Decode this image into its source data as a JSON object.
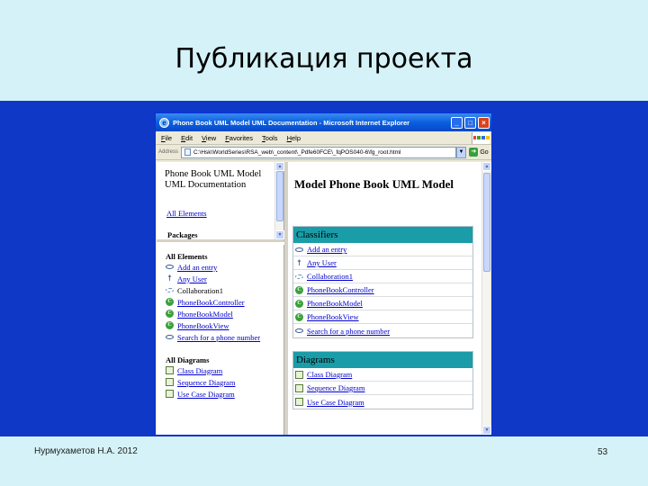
{
  "slide": {
    "title": "Публикация проекта",
    "footer_author": "Нурмухаметов Н.А. 2012",
    "page_number": "53"
  },
  "browser": {
    "title": "Phone Book UML Model UML Documentation - Microsoft Internet Explorer",
    "menu": [
      "File",
      "Edit",
      "View",
      "Favorites",
      "Tools",
      "Help"
    ],
    "address_label": "Address",
    "address": "C:\\Hsk\\WorldSeries\\RSA_web\\_content\\_Pdfe60FCE\\_fqPOS040-6\\fg_root.html",
    "go_label": "Go",
    "window_controls": [
      "minimize-icon",
      "maximize-icon",
      "close-icon"
    ]
  },
  "left_top": {
    "doc_title": "Phone Book UML Model UML Documentation",
    "all_elements_link": "All Elements",
    "packages_label": "Packages"
  },
  "left_bottom": {
    "all_elements_head": "All Elements",
    "elements": [
      {
        "label": "Add an entry",
        "icon": "use-case-icon",
        "link": true
      },
      {
        "label": "Any User",
        "icon": "actor-icon",
        "link": true
      },
      {
        "label": "Collaboration1",
        "icon": "collaboration-icon",
        "link": false
      },
      {
        "label": "PhoneBookController",
        "icon": "class-icon",
        "link": true
      },
      {
        "label": "PhoneBookModel",
        "icon": "class-icon",
        "link": true
      },
      {
        "label": "PhoneBookView",
        "icon": "class-icon",
        "link": true
      },
      {
        "label": "Search for a phone number",
        "icon": "use-case-icon",
        "link": true
      }
    ],
    "all_diagrams_head": "All Diagrams",
    "diagrams": [
      {
        "label": "Class Diagram",
        "icon": "diagram-icon"
      },
      {
        "label": "Sequence Diagram",
        "icon": "diagram-icon"
      },
      {
        "label": "Use Case Diagram",
        "icon": "diagram-icon"
      }
    ]
  },
  "right": {
    "model_title": "Model Phone Book UML Model",
    "classifiers_head": "Classifiers",
    "classifiers": [
      {
        "label": "Add an entry",
        "icon": "use-case-icon",
        "link": true
      },
      {
        "label": "Any User",
        "icon": "actor-icon",
        "link": true
      },
      {
        "label": "Collaboration1",
        "icon": "collaboration-icon",
        "link": true
      },
      {
        "label": "PhoneBookController",
        "icon": "class-icon",
        "link": true
      },
      {
        "label": "PhoneBookModel",
        "icon": "class-icon",
        "link": true
      },
      {
        "label": "PhoneBookView",
        "icon": "class-icon",
        "link": true
      },
      {
        "label": "Search for a phone number",
        "icon": "use-case-icon",
        "link": true
      }
    ],
    "diagrams_head": "Diagrams",
    "diagrams": [
      {
        "label": "Class Diagram",
        "icon": "diagram-icon"
      },
      {
        "label": "Sequence Diagram",
        "icon": "diagram-icon"
      },
      {
        "label": "Use Case Diagram",
        "icon": "diagram-icon"
      }
    ]
  }
}
